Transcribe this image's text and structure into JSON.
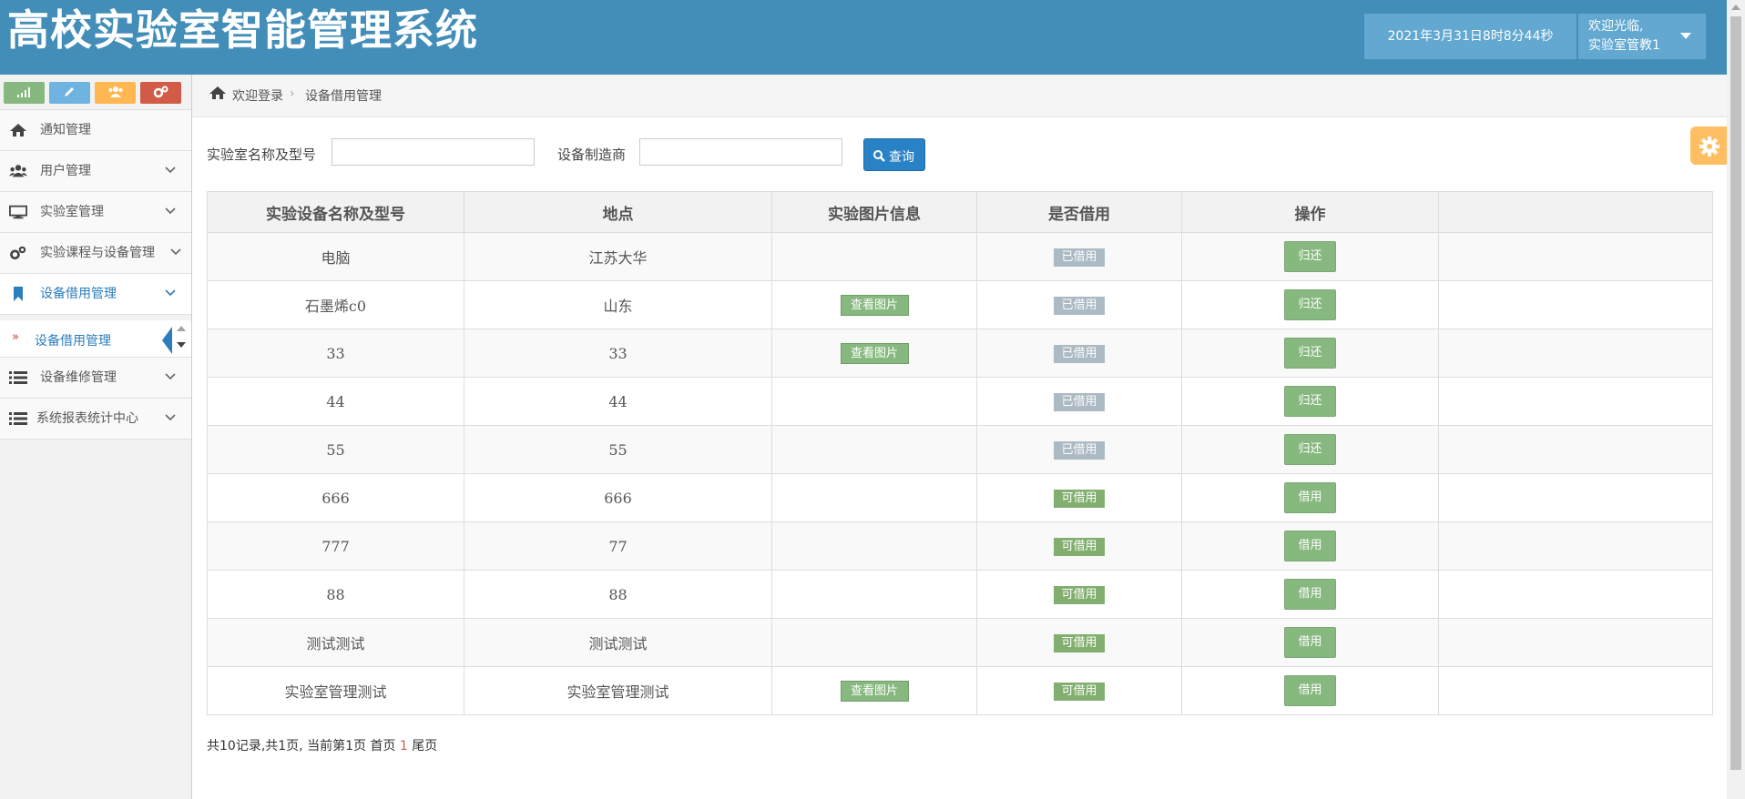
{
  "header": {
    "title": "高校实验室智能管理系统",
    "datetime": "2021年3月31日8时8分44秒",
    "welcome": "欢迎光临,",
    "user": "实验室管教1"
  },
  "shortcuts": [
    {
      "icon": "signal-icon",
      "color": "#87b87f"
    },
    {
      "icon": "pencil-icon",
      "color": "#6fb3e0"
    },
    {
      "icon": "users-icon",
      "color": "#ffb752"
    },
    {
      "icon": "cogs-icon",
      "color": "#d15b47"
    }
  ],
  "sidebar": {
    "items": [
      {
        "label": "通知管理",
        "icon": "home-icon"
      },
      {
        "label": "用户管理",
        "icon": "users-icon"
      },
      {
        "label": "实验室管理",
        "icon": "desktop-icon"
      },
      {
        "label": "实验课程与设备管理",
        "icon": "cogs-icon"
      },
      {
        "label": "设备借用管理",
        "icon": "bookmark-icon"
      },
      {
        "label": "设备维修管理",
        "icon": "list-icon"
      },
      {
        "label": "系统报表统计中心",
        "icon": "list-icon"
      }
    ],
    "submenu": {
      "label": "设备借用管理"
    }
  },
  "breadcrumb": {
    "home": "欢迎登录",
    "current": "设备借用管理"
  },
  "search": {
    "name_label": "实验室名称及型号",
    "name_value": "",
    "maker_label": "设备制造商",
    "maker_value": "",
    "button": "查询"
  },
  "table": {
    "columns": [
      "实验设备名称及型号",
      "地点",
      "实验图片信息",
      "是否借用",
      "操作",
      ""
    ],
    "rows": [
      {
        "name": "电脑",
        "place": "江苏大华",
        "pic": "",
        "status": "已借用",
        "action": "归还"
      },
      {
        "name": "石墨烯c0",
        "place": "山东",
        "pic": "查看图片",
        "status": "已借用",
        "action": "归还"
      },
      {
        "name": "33",
        "place": "33",
        "pic": "查看图片",
        "status": "已借用",
        "action": "归还"
      },
      {
        "name": "44",
        "place": "44",
        "pic": "",
        "status": "已借用",
        "action": "归还"
      },
      {
        "name": "55",
        "place": "55",
        "pic": "",
        "status": "已借用",
        "action": "归还"
      },
      {
        "name": "666",
        "place": "666",
        "pic": "",
        "status": "可借用",
        "action": "借用"
      },
      {
        "name": "777",
        "place": "77",
        "pic": "",
        "status": "可借用",
        "action": "借用"
      },
      {
        "name": "88",
        "place": "88",
        "pic": "",
        "status": "可借用",
        "action": "借用"
      },
      {
        "name": "测试测试",
        "place": "测试测试",
        "pic": "",
        "status": "可借用",
        "action": "借用"
      },
      {
        "name": "实验室管理测试",
        "place": "实验室管理测试",
        "pic": "查看图片",
        "status": "可借用",
        "action": "借用"
      }
    ]
  },
  "pager": {
    "summary": "共10记录,共1页, 当前第1页",
    "first": "首页",
    "current": "1",
    "last": "尾页"
  },
  "colors": {
    "header": "#438eb9",
    "accent": "#2b7dbc",
    "borrowed": "#abbac3",
    "available": "#82af6f"
  }
}
